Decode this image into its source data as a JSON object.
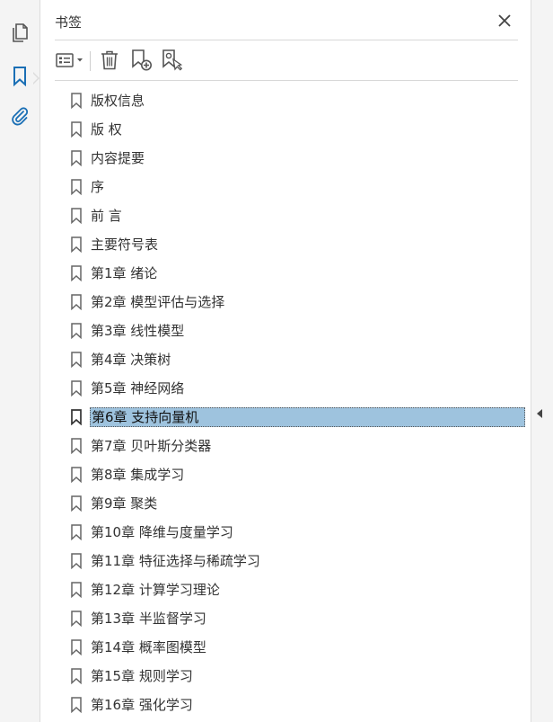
{
  "panel": {
    "title": "书签"
  },
  "toolbar": {
    "options_icon": "options-menu-icon",
    "delete_icon": "trash-icon",
    "new_bookmark_icon": "new-bookmark-icon",
    "find_bookmark_icon": "find-bookmark-icon"
  },
  "colors": {
    "accent": "#1a6fb5",
    "selection": "#9ec3de",
    "text": "#333333",
    "sidebar_bg": "#f4f4f4"
  },
  "bookmarks": [
    {
      "label": "版权信息",
      "selected": false
    },
    {
      "label": "版 权",
      "selected": false
    },
    {
      "label": "内容提要",
      "selected": false
    },
    {
      "label": "序",
      "selected": false
    },
    {
      "label": "前 言",
      "selected": false
    },
    {
      "label": "主要符号表",
      "selected": false
    },
    {
      "label": "第1章 绪论",
      "selected": false
    },
    {
      "label": "第2章 模型评估与选择",
      "selected": false
    },
    {
      "label": "第3章 线性模型",
      "selected": false
    },
    {
      "label": "第4章 决策树",
      "selected": false
    },
    {
      "label": "第5章 神经网络",
      "selected": false
    },
    {
      "label": "第6章 支持向量机",
      "selected": true
    },
    {
      "label": "第7章 贝叶斯分类器",
      "selected": false
    },
    {
      "label": "第8章 集成学习",
      "selected": false
    },
    {
      "label": "第9章 聚类",
      "selected": false
    },
    {
      "label": "第10章 降维与度量学习",
      "selected": false
    },
    {
      "label": "第11章 特征选择与稀疏学习",
      "selected": false
    },
    {
      "label": "第12章 计算学习理论",
      "selected": false
    },
    {
      "label": "第13章 半监督学习",
      "selected": false
    },
    {
      "label": "第14章 概率图模型",
      "selected": false
    },
    {
      "label": "第15章 规则学习",
      "selected": false
    },
    {
      "label": "第16章 强化学习",
      "selected": false
    }
  ]
}
